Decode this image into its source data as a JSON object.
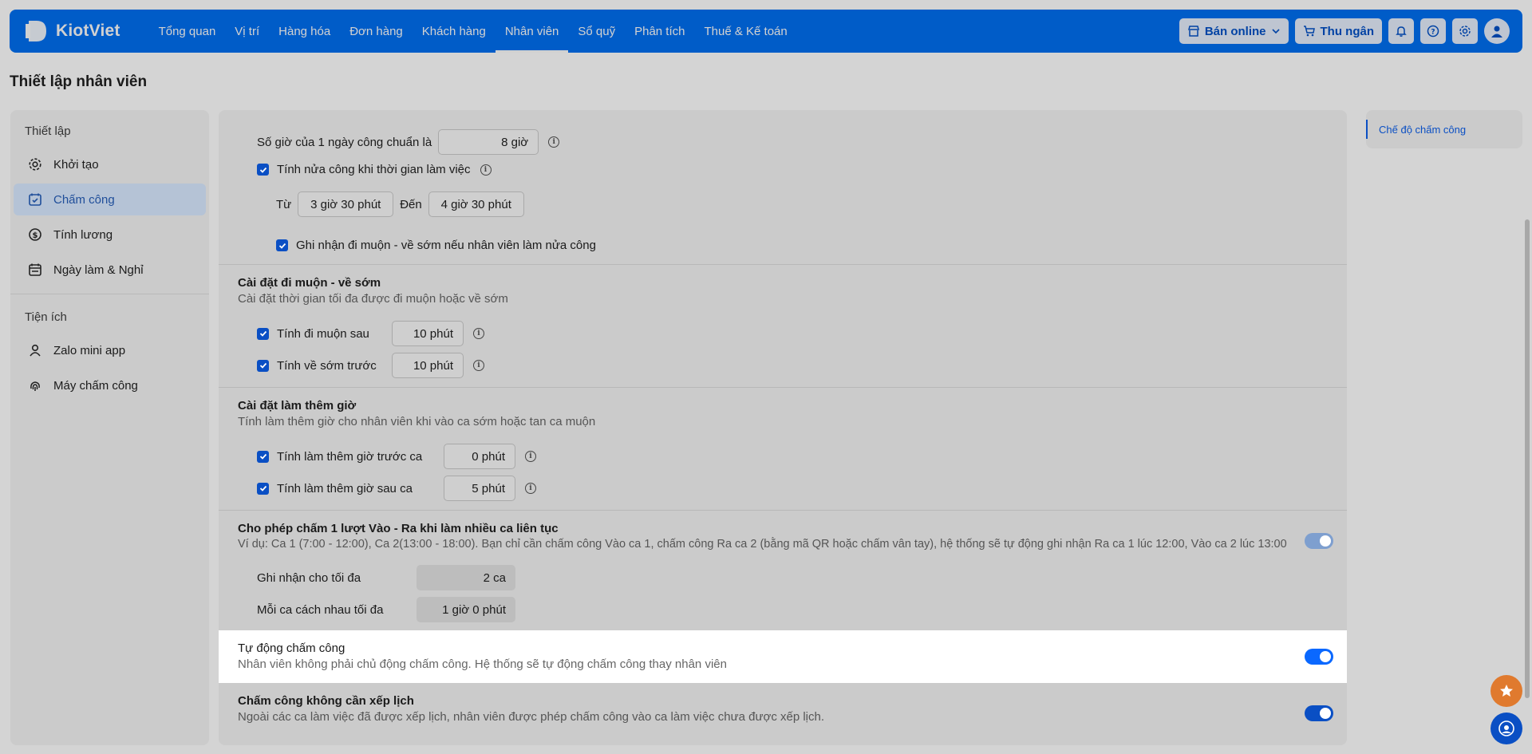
{
  "app": {
    "logo_text": "KiotViet"
  },
  "nav": {
    "items": [
      "Tổng quan",
      "Vị trí",
      "Hàng hóa",
      "Đơn hàng",
      "Khách hàng",
      "Nhân viên",
      "Sổ quỹ",
      "Phân tích",
      "Thuế & Kế toán"
    ],
    "active": "Nhân viên"
  },
  "top_actions": {
    "online_label": "Bán online",
    "cashier_label": "Thu ngân"
  },
  "page": {
    "title": "Thiết lập nhân viên"
  },
  "sidebar": {
    "group1": "Thiết lập",
    "items1": [
      {
        "label": "Khởi tạo",
        "icon": "gear-icon"
      },
      {
        "label": "Chấm công",
        "icon": "calendar-check-icon",
        "active": true
      },
      {
        "label": "Tính lương",
        "icon": "dollar-icon"
      },
      {
        "label": "Ngày làm & Nghỉ",
        "icon": "calendar-icon"
      }
    ],
    "group2": "Tiện ích",
    "items2": [
      {
        "label": "Zalo mini app",
        "icon": "user-icon"
      },
      {
        "label": "Máy chấm công",
        "icon": "fingerprint-icon"
      }
    ]
  },
  "workday": {
    "hours_label": "Số giờ của 1 ngày công chuẩn là",
    "hours_value": "8 giờ",
    "half_label": "Tính nửa công khi thời gian làm việc",
    "from_label": "Từ",
    "from_value": "3 giờ 30 phút",
    "to_label": "Đến",
    "to_value": "4 giờ 30 phút",
    "late_half_label": "Ghi nhận đi muộn - về sớm nếu nhân viên làm nửa công"
  },
  "late_early": {
    "title": "Cài đặt đi muộn - về sớm",
    "desc": "Cài đặt thời gian tối đa được đi muộn hoặc về sớm",
    "late_label": "Tính đi muộn sau",
    "late_value": "10 phút",
    "early_label": "Tính về sớm trước",
    "early_value": "10 phút"
  },
  "overtime": {
    "title": "Cài đặt làm thêm giờ",
    "desc": "Tính làm thêm giờ cho nhân viên khi vào ca sớm hoặc tan ca muộn",
    "before_label": "Tính làm thêm giờ trước ca",
    "before_value": "0 phút",
    "after_label": "Tính làm thêm giờ sau ca",
    "after_value": "5 phút"
  },
  "multi_shift": {
    "title": "Cho phép chấm 1 lượt Vào - Ra khi làm nhiều ca liên tục",
    "desc": "Ví dụ: Ca 1 (7:00 - 12:00), Ca 2(13:00 - 18:00). Bạn chỉ cần chấm công Vào ca 1, chấm công Ra ca 2 (bằng mã QR hoặc chấm vân tay), hệ thống sẽ tự động ghi nhận Ra ca 1 lúc 12:00, Vào ca 2 lúc 13:00",
    "max_label": "Ghi nhận cho tối đa",
    "max_value": "2 ca",
    "gap_label": "Mỗi ca cách nhau tối đa",
    "gap_value": "1 giờ 0 phút"
  },
  "auto_attendance": {
    "title": "Tự động chấm công",
    "desc": "Nhân viên không phải chủ động chấm công. Hệ thống sẽ tự động chấm công thay nhân viên"
  },
  "no_schedule": {
    "title": "Chấm công không cần xếp lịch",
    "desc": "Ngoài các ca làm việc đã được xếp lịch, nhân viên được phép chấm công vào ca làm việc chưa được xếp lịch."
  },
  "rail": {
    "link": "Chế độ chấm công"
  },
  "colors": {
    "brand": "#0070f4",
    "accent": "#0a4fc4",
    "star": "#e07a2e"
  }
}
